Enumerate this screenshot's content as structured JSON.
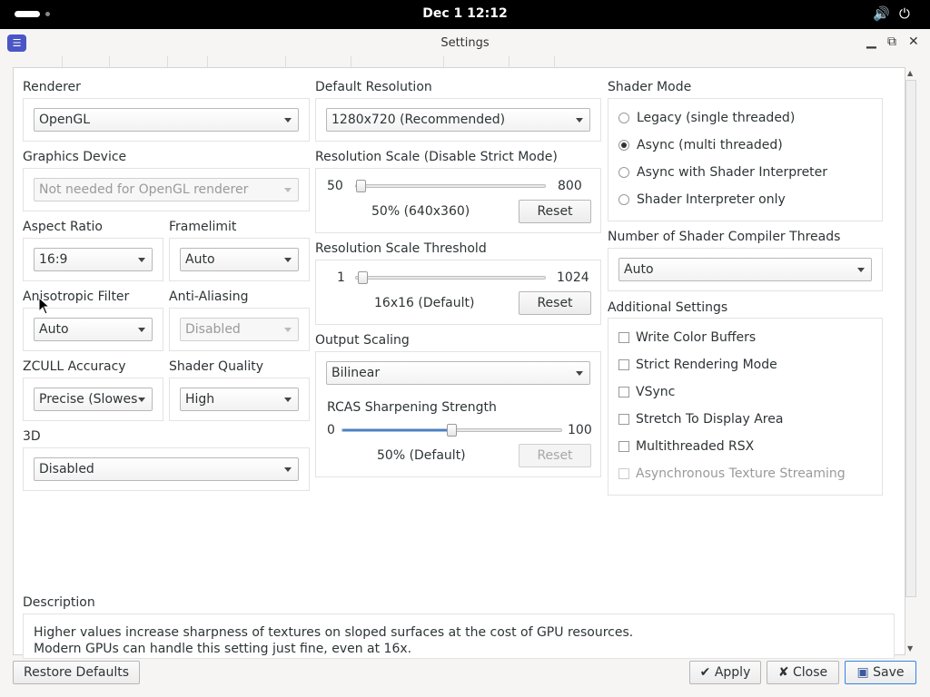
{
  "topbar": {
    "clock": "Dec 1  12:12",
    "volume_icon": "🔊",
    "power_icon": "⏻"
  },
  "window": {
    "title": "Settings",
    "minimize": "▁",
    "maximize": "⧉",
    "close": "✕"
  },
  "col1": {
    "renderer": {
      "label": "Renderer",
      "value": "OpenGL"
    },
    "graphics_device": {
      "label": "Graphics Device",
      "value": "Not needed for OpenGL renderer"
    },
    "aspect_ratio": {
      "label": "Aspect Ratio",
      "value": "16:9"
    },
    "framelimit": {
      "label": "Framelimit",
      "value": "Auto"
    },
    "anisotropic": {
      "label": "Anisotropic Filter",
      "value": "Auto"
    },
    "anti_aliasing": {
      "label": "Anti-Aliasing",
      "value": "Disabled"
    },
    "zcull": {
      "label": "ZCULL Accuracy",
      "value": "Precise (Slowes"
    },
    "shader_quality": {
      "label": "Shader Quality",
      "value": "High"
    },
    "three_d": {
      "label": "3D",
      "value": "Disabled"
    }
  },
  "col2": {
    "default_resolution": {
      "label": "Default Resolution",
      "value": "1280x720 (Recommended)"
    },
    "resolution_scale": {
      "label": "Resolution Scale (Disable Strict Mode)",
      "min": "50",
      "max": "800",
      "value_text": "50% (640x360)",
      "reset": "Reset",
      "position": 0.0
    },
    "scale_threshold": {
      "label": "Resolution Scale Threshold",
      "min": "1",
      "max": "1024",
      "value_text": "16x16 (Default)",
      "reset": "Reset",
      "position": 0.01
    },
    "output_scaling": {
      "label": "Output Scaling",
      "value": "Bilinear"
    },
    "rcas": {
      "label": "RCAS Sharpening Strength",
      "min": "0",
      "max": "100",
      "value_text": "50% (Default)",
      "reset": "Reset",
      "position": 0.5
    }
  },
  "col3": {
    "shader_mode": {
      "label": "Shader Mode",
      "options": [
        "Legacy (single threaded)",
        "Async (multi threaded)",
        "Async with Shader Interpreter",
        "Shader Interpreter only"
      ],
      "selected": 1
    },
    "compiler_threads": {
      "label": "Number of Shader Compiler Threads",
      "value": "Auto"
    },
    "additional": {
      "label": "Additional Settings",
      "items": [
        "Write Color Buffers",
        "Strict Rendering Mode",
        "VSync",
        "Stretch To Display Area",
        "Multithreaded RSX",
        "Asynchronous Texture Streaming"
      ]
    }
  },
  "description": {
    "label": "Description",
    "line1": "Higher values increase sharpness of textures on sloped surfaces at the cost of GPU resources.",
    "line2": "Modern GPUs can handle this setting just fine, even at 16x."
  },
  "footer": {
    "restore": "Restore Defaults",
    "apply": "Apply",
    "close": "Close",
    "save": "Save"
  },
  "colors": {
    "accent": "#3584e4",
    "topbar": "#000000"
  }
}
